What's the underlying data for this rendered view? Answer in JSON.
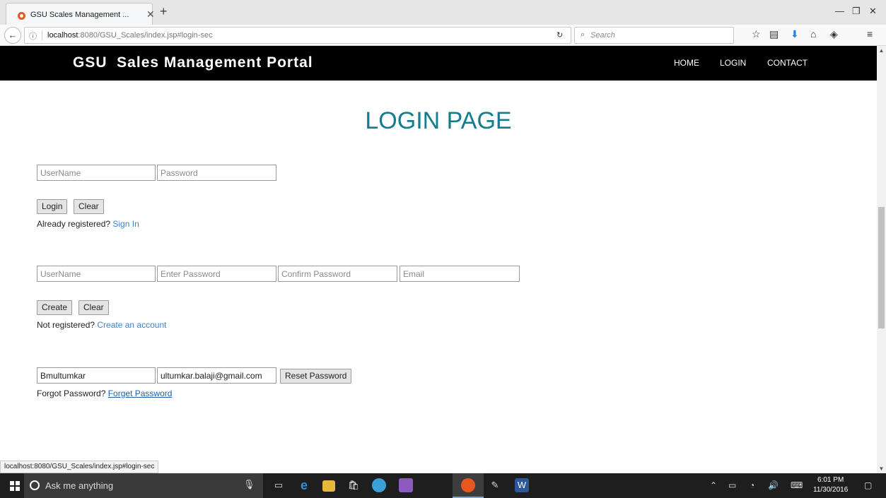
{
  "browser": {
    "tab_title": "GSU Scales Management ...",
    "url_host": "localhost",
    "url_rest": ":8080/GSU_Scales/index.jsp#login-sec",
    "search_placeholder": "Search",
    "status_url": "localhost:8080/GSU_Scales/index.jsp#login-sec"
  },
  "site": {
    "brand": "GSU  Sales Management Portal",
    "nav": [
      "HOME",
      "LOGIN",
      "CONTACT"
    ]
  },
  "page_title": "LOGIN PAGE",
  "login": {
    "username_placeholder": "UserName",
    "password_placeholder": "Password",
    "login_label": "Login",
    "clear_label": "Clear",
    "prompt": "Already registered? ",
    "link": "Sign In"
  },
  "signup": {
    "username_placeholder": "UserName",
    "password_placeholder": "Enter Password",
    "confirm_placeholder": "Confirm Password",
    "email_placeholder": "Email",
    "create_label": "Create",
    "clear_label": "Clear",
    "prompt": "Not registered? ",
    "link": "Create an account"
  },
  "reset": {
    "username_value": "Bmultumkar",
    "email_value": "ultumkar.balaji@gmail.com",
    "reset_label": "Reset Password",
    "prompt": "Forgot Password? ",
    "link": "Forget Password"
  },
  "taskbar": {
    "search_text": "Ask me anything",
    "time": "6:01 PM",
    "date": "11/30/2016"
  },
  "colors": {
    "title": "#137c8e",
    "header_bg": "#000000",
    "link": "#3b83c9"
  }
}
